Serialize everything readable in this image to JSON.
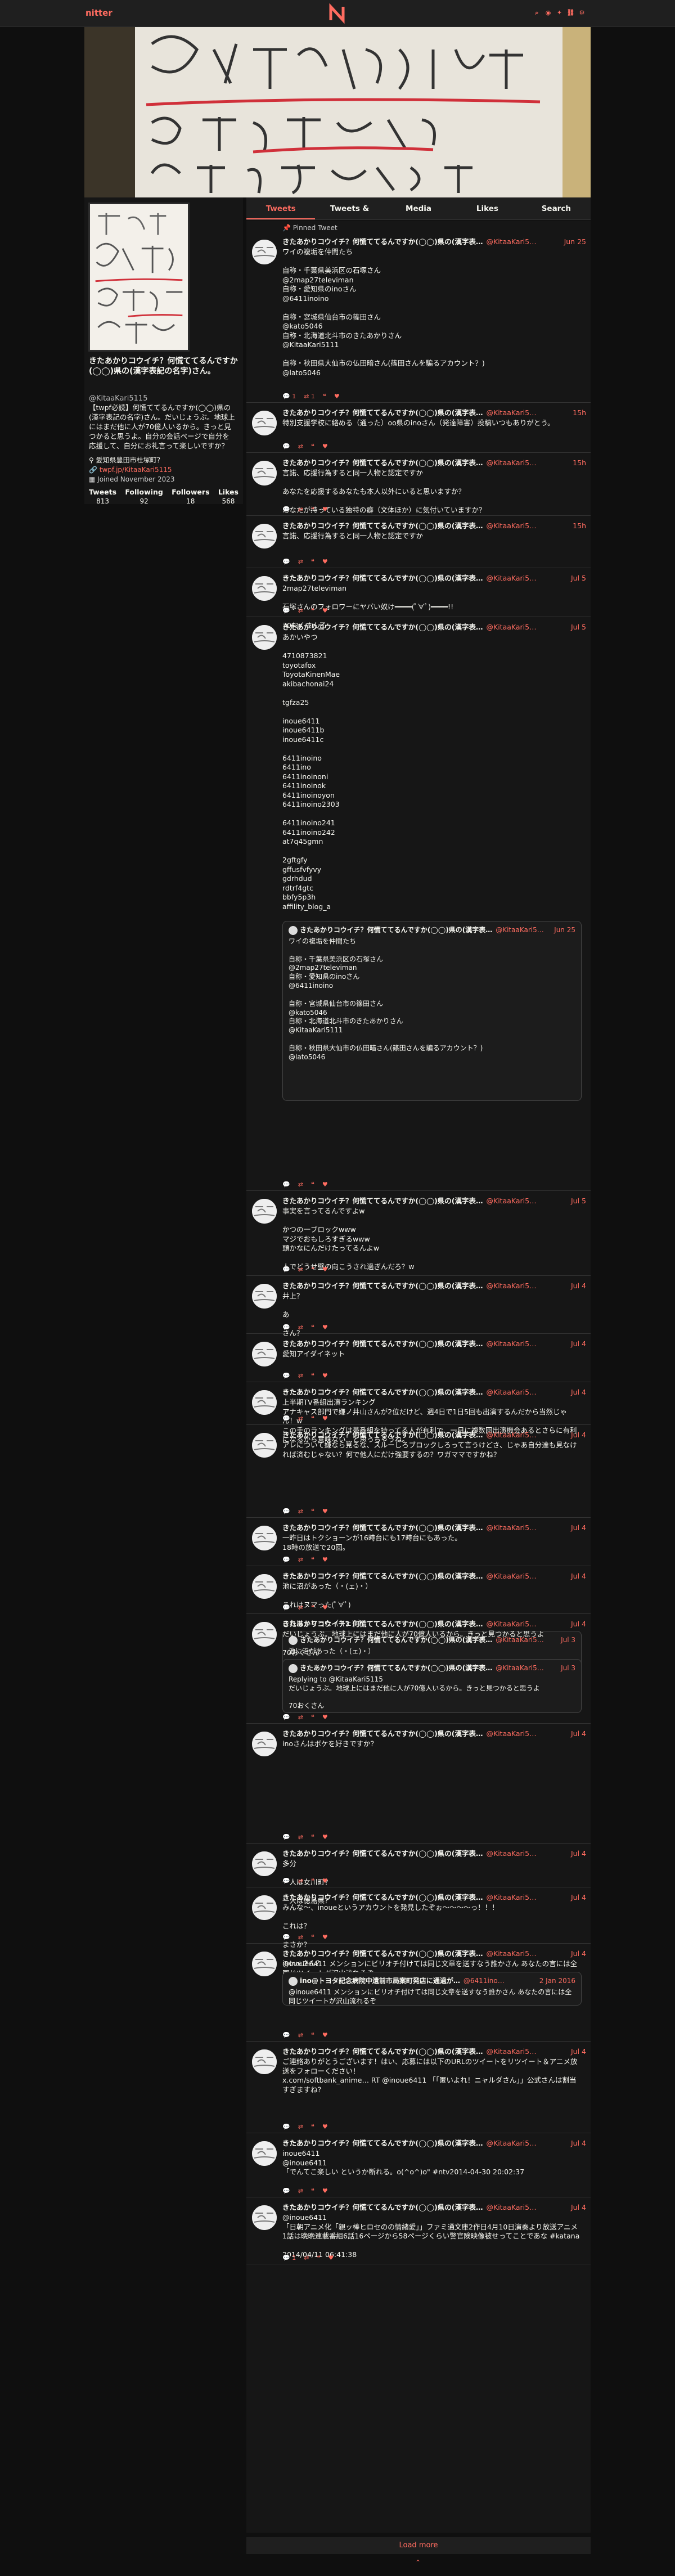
{
  "nav": {
    "brand": "nitter"
  },
  "tabs": [
    "Tweets",
    "Tweets & Replies",
    "Media",
    "Likes",
    "Search"
  ],
  "profile": {
    "name": "きたあかりコウイチ？何慌ててるんですか(◯◯)県の(漢字表記の名字)さん。",
    "handle": "@KitaaKari5115",
    "bio": "【twpf必読】何慌ててるんですか(◯◯)県の(漢字表記の名字)さん。だいじょうぶ。地球上にはまだ他に人が70億人いるから。きっと見つかると思うよ。自分の会話ページで自分を応援して、自分にお礼言って楽しいですか？",
    "location": "愛知県豊田市杜塚町？",
    "website": "twpf.jp/KitaaKari5115",
    "joined": "Joined November 2023",
    "stats": [
      {
        "label": "Tweets",
        "value": "813"
      },
      {
        "label": "Following",
        "value": "92"
      },
      {
        "label": "Followers",
        "value": "18"
      },
      {
        "label": "Likes",
        "value": "568"
      }
    ]
  },
  "tweets": [
    {
      "pinned": "Pinned Tweet",
      "name": "きたあかりコウイチ？何慌ててるんですか(◯◯)県の(漢字表…",
      "user": "@KitaaKari5…",
      "date": "Jun 25",
      "body": "ワイの複垢を仲間たち\n\n自称・千葉県美浜区の石塚さん\n@2map27televiman\n自称・愛知県のinoさん\n@6411inoino\n\n自称・宮城県仙台市の篠田さん\n@kato5046\n自称・北海道北斗市のきたあかりさん\n@KitaaKari5111\n\n自称・秋田県大仙市の仏田暗さん(篠田さんを騙るアカウント？)\n@lato5046",
      "stats": [
        "1",
        "1",
        "",
        ""
      ]
    },
    {
      "name": "きたあかりコウイチ？何慌ててるんですか(◯◯)県の(漢字表…",
      "user": "@KitaaKari5…",
      "date": "15h",
      "body": "特別支援学校に絡める（通った）oo県のinoさん（発達障害）投稿いつもありがとう。",
      "stats": [
        "",
        "",
        "",
        ""
      ]
    },
    {
      "name": "きたあかりコウイチ？何慌ててるんですか(◯◯)県の(漢字表…",
      "user": "@KitaaKari5…",
      "date": "15h",
      "body": "言諾、応援行為すると同一人物と認定ですか\n\nあなたを応援するあなたも本人以外にいると思いますか？\n\nあなたが持っている独特の癖（文体ほか）に気付いていますか？",
      "stats": [
        "",
        "",
        "",
        ""
      ]
    },
    {
      "name": "きたあかりコウイチ？何慌ててるんですか(◯◯)県の(漢字表…",
      "user": "@KitaaKari5…",
      "date": "15h",
      "body": "言諾、応援行為すると同一人物と認定ですか",
      "stats": [
        "",
        "",
        "",
        ""
      ]
    },
    {
      "name": "きたあかりコウイチ？何慌ててるんですか(◯◯)県の(漢字表…",
      "user": "@KitaaKari5…",
      "date": "Jul 5",
      "body": "2map27televiman\n\n石塚さんのフォロワーにヤバい奴け━━━━(ﾟ∀ﾟ)━━━━!!\n\n70おくさん乙",
      "stats": [
        "",
        "",
        "",
        ""
      ]
    },
    {
      "name": "きたあかりコウイチ？何慌ててるんですか(◯◯)県の(漢字表…",
      "user": "@KitaaKari5…",
      "date": "Jul 5",
      "body": "あかいやつ\n\n4710873821\ntoyotafox\nToyotaKinenMae\nakibachonai24\n\ntgfza25\n\ninoue6411\ninoue6411b\ninoue6411c\n\n6411inoino\n6411ino\n6411inoinoni\n6411inoinok\n6411inoinoyon\n6411inoino2303\n\n6411inoino241\n6411inoino242\nat7q45gmn\n\n2gftgfy\ngffusfvfyvy\ngdrhdud\nrdtrf4gtc\nbbfy5p3h\naffility_blog_a",
      "stats": [
        "",
        "",
        "",
        ""
      ],
      "quote": {
        "name": "きたあかりコウイチ？何慌ててるんですか(◯◯)県の(漢字表…",
        "user": "@KitaaKari5…",
        "date": "Jun 25",
        "body": "ワイの複垢を仲間たち\n\n自称・千葉県美浜区の石塚さん\n@2map27televiman\n自称・愛知県のinoさん\n@6411inoino\n\n自称・宮城県仙台市の篠田さん\n@kato5046\n自称・北海道北斗市のきたあかりさん\n@KitaaKari5111\n\n自称・秋田県大仙市の仏田暗さん(篠田さんを騙るアカウント？)\n@lato5046"
      }
    },
    {
      "name": "きたあかりコウイチ？何慌ててるんですか(◯◯)県の(漢字表…",
      "user": "@KitaaKari5…",
      "date": "Jul 5",
      "body": "事実を言ってるんですよw\n\nかつの一ブロックwww\nマジでおもしろすぎるwww\n頭かなにんだけたってるんよw\n\n人でどうせ壁の向こうされ過ぎんだろ？w",
      "stats": [
        "",
        "",
        "",
        ""
      ]
    },
    {
      "name": "きたあかりコウイチ？何慌ててるんですか(◯◯)県の(漢字表…",
      "user": "@KitaaKari5…",
      "date": "Jul 4",
      "body": "井上？\n\nあ\n\nさん？",
      "stats": [
        "",
        "",
        "",
        ""
      ]
    },
    {
      "name": "きたあかりコウイチ？何慌ててるんですか(◯◯)県の(漢字表…",
      "user": "@KitaaKari5…",
      "date": "Jul 4",
      "body": "愛知アイダイネット",
      "stats": [
        "",
        "",
        "",
        ""
      ]
    },
    {
      "name": "きたあかりコウイチ？何慌ててるんですか(◯◯)県の(漢字表…",
      "user": "@KitaaKari5…",
      "date": "Jul 4",
      "body": "上半期TV番組出演ランキング\nアナキャス部門で嫌ノ井山さんが2位だけど、週4日で1日5回も出演するんだから当然じゃん！w\nこの手のランキングは帯番組を持ってる人が有利で、一日に複数回出演機会あるとさらに有利になるから意味ない…と思っちゃうね。",
      "stats": [
        "",
        "",
        "",
        ""
      ]
    },
    {
      "name": "きたあかりコウイチ？何慌ててるんですか(◯◯)県の(漢字表…",
      "user": "@KitaaKari5…",
      "date": "Jul 4",
      "body": "アレについて嫌なら見るな、スルーしろブロックしろって言うけどさ、じゃあ自分達も見なければ済むじゃない？何で他人にだけ強要するの？ワガママですかね？",
      "stats": [
        "",
        "",
        "",
        ""
      ]
    },
    {
      "name": "きたあかりコウイチ？何慌ててるんですか(◯◯)県の(漢字表…",
      "user": "@KitaaKari5…",
      "date": "Jul 4",
      "body": "一昨日はトクショーンが16時台にも17時台にもあった。\n18時の放送で20回。",
      "stats": [
        "",
        "",
        "",
        ""
      ]
    },
    {
      "name": "きたあかりコウイチ？何慌ててるんですか(◯◯)県の(漢字表…",
      "user": "@KitaaKari5…",
      "date": "Jul 4",
      "body": "池に沼があった（・(ェ)・）\n\nこれはヌマった(ﾟ∀ﾟ)\n\nこれはヌマった（´(ェ)`）",
      "stats": [
        "",
        "",
        "",
        ""
      ],
      "quote": {
        "name": "きたあかりコウイチ？何慌ててるんですか(◯◯)県の(漢字表…",
        "user": "@KitaaKari5…",
        "date": "Jul 3",
        "body": "池に沼があった（・(ェ)・）\n\nこれはヌマった(ﾟ∀ﾟ)\n\nこれはヌマった（´(ェ)`）"
      }
    },
    {
      "name": "きたあかりコウイチ？何慌ててるんですか(◯◯)県の(漢字表…",
      "user": "@KitaaKari5…",
      "date": "Jul 4",
      "body": "だいじょうぶ。地球上にはまだ他に人が70億人いるから。きっと見つかると思うよ\n\n70おくさん",
      "stats": [
        "",
        "",
        "",
        ""
      ],
      "quote": {
        "name": "きたあかりコウイチ？何慌ててるんですか(◯◯)県の(漢字表…",
        "user": "@KitaaKari5…",
        "date": "Jul 3",
        "body": "Replying to @KitaaKari5115\nだいじょうぶ。地球上にはまだ他に人が70億人いるから。きっと見つかると思うよ\n\n70おくさん"
      }
    },
    {
      "name": "きたあかりコウイチ？何慌ててるんですか(◯◯)県の(漢字表…",
      "user": "@KitaaKari5…",
      "date": "Jul 4",
      "body": "inoさんはボケを好きですか？",
      "stats": [
        "",
        "",
        "",
        ""
      ]
    },
    {
      "name": "きたあかりコウイチ？何慌ててるんですか(◯◯)県の(漢字表…",
      "user": "@KitaaKari5…",
      "date": "Jul 4",
      "body": "多分\n\n一人は女川町？\n\n一人は徳島県？",
      "stats": [
        "",
        "",
        "",
        ""
      ]
    },
    {
      "name": "きたあかりコウイチ？何慌ててるんですか(◯◯)県の(漢字表…",
      "user": "@KitaaKari5…",
      "date": "Jul 4",
      "body": "みんな〜、inoueというアカウントを発見したぞぉ〜〜〜〜っ！！！\n\nこれは？\n\nまさか？\n\ninoueさん？\n\nワイが書いたのではないよ。そんなアカウントがあったんやwww",
      "stats": [
        "",
        "",
        "",
        ""
      ]
    },
    {
      "name": "きたあかりコウイチ？何慌ててるんですか(◯◯)県の(漢字表…",
      "user": "@KitaaKari5…",
      "date": "Jul 4",
      "body": "@inoue6411 メンションにビリオチ付けては同じ文章を送すなう誰かさん あなたの言には全同じツイートが沢山流れるぞ",
      "stats": [
        "",
        "",
        "",
        ""
      ],
      "quote": {
        "name": "ino@トヨタ記念病院中遺前市局案町発店に通過が…",
        "user": "@6411ino…",
        "date": "2 Jan 2016",
        "body": "@inoue6411 メンションにビリオチ付けては同じ文章を送すなう誰かさん あなたの言には全同じツイートが沢山流れるぞ"
      }
    },
    {
      "name": "きたあかりコウイチ？何慌ててるんですか(◯◯)県の(漢字表…",
      "user": "@KitaaKari5…",
      "date": "Jul 4",
      "body": "ご連絡ありがとうございます！はい、応募には以下のURLのツイートをリツイート＆アニメ放送をフォローください！\nx.com/softbank_anime… RT @inoue6411 「「匿いよれ！ニャルダさん」」公式さんは割当すぎますね？",
      "stats": [
        "",
        "",
        "",
        ""
      ]
    },
    {
      "name": "きたあかりコウイチ？何慌ててるんですか(◯◯)県の(漢字表…",
      "user": "@KitaaKari5…",
      "date": "Jul 4",
      "body": "inoue6411\n@inoue6411\n「でんてこ楽しい というか断れる。o(^o^)o\" #ntv2014-04-30 20:02:37",
      "stats": [
        "",
        "",
        "",
        ""
      ]
    },
    {
      "name": "きたあかりコウイチ？何慌ててるんですか(◯◯)県の(漢字表…",
      "user": "@KitaaKari5…",
      "date": "Jul 4",
      "body": "@inoue6411\n「日朝アニメ化「親ッ棒ヒロセのの情緒愛」」ファミ通文庫2作日4月10日演奏より放送アニメ1話は晩晩連載番組6話16ページから58ページくらい警官険映像被せってことであな #katana\n\n2014/04/11 06:41:38",
      "stats": [
        "1",
        "",
        "",
        ""
      ]
    }
  ],
  "loadmore": "Load more"
}
